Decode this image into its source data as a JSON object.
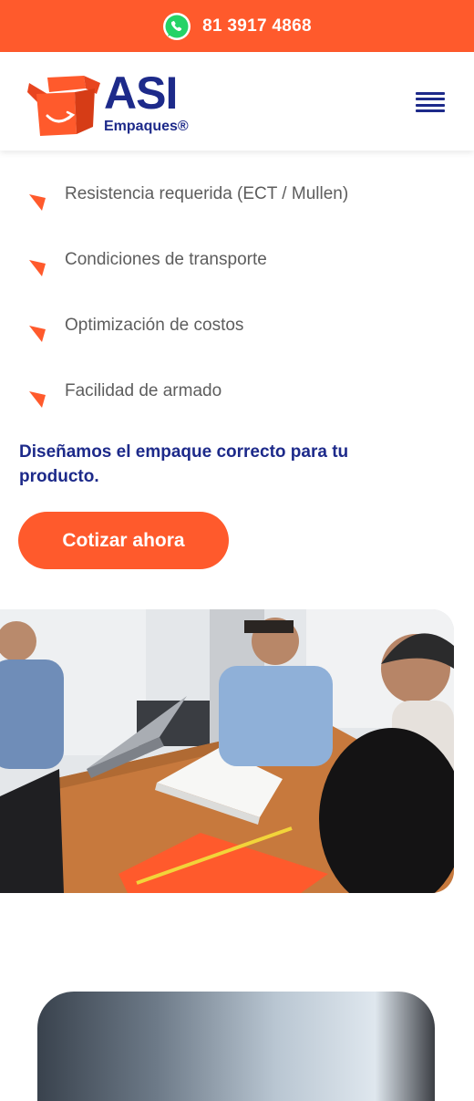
{
  "topbar": {
    "icon": "whatsapp-icon",
    "phone": "81 3917 4868",
    "color": "#ff5a2c"
  },
  "header": {
    "logo_title": "ASI",
    "logo_subtitle": "Empaques®",
    "menu_icon": "hamburger-menu-icon",
    "brand_color": "#1d2a8a"
  },
  "features": [
    {
      "label": "Resistencia requerida (ECT / Mullen)"
    },
    {
      "label": "Condiciones de transporte"
    },
    {
      "label": "Optimización de costos"
    },
    {
      "label": "Facilidad de armado"
    }
  ],
  "tagline": "Diseñamos el empaque correcto para tu producto.",
  "cta": {
    "label": "Cotizar ahora",
    "color": "#ff5a2c"
  },
  "photo": {
    "icon": "meeting-photo"
  }
}
